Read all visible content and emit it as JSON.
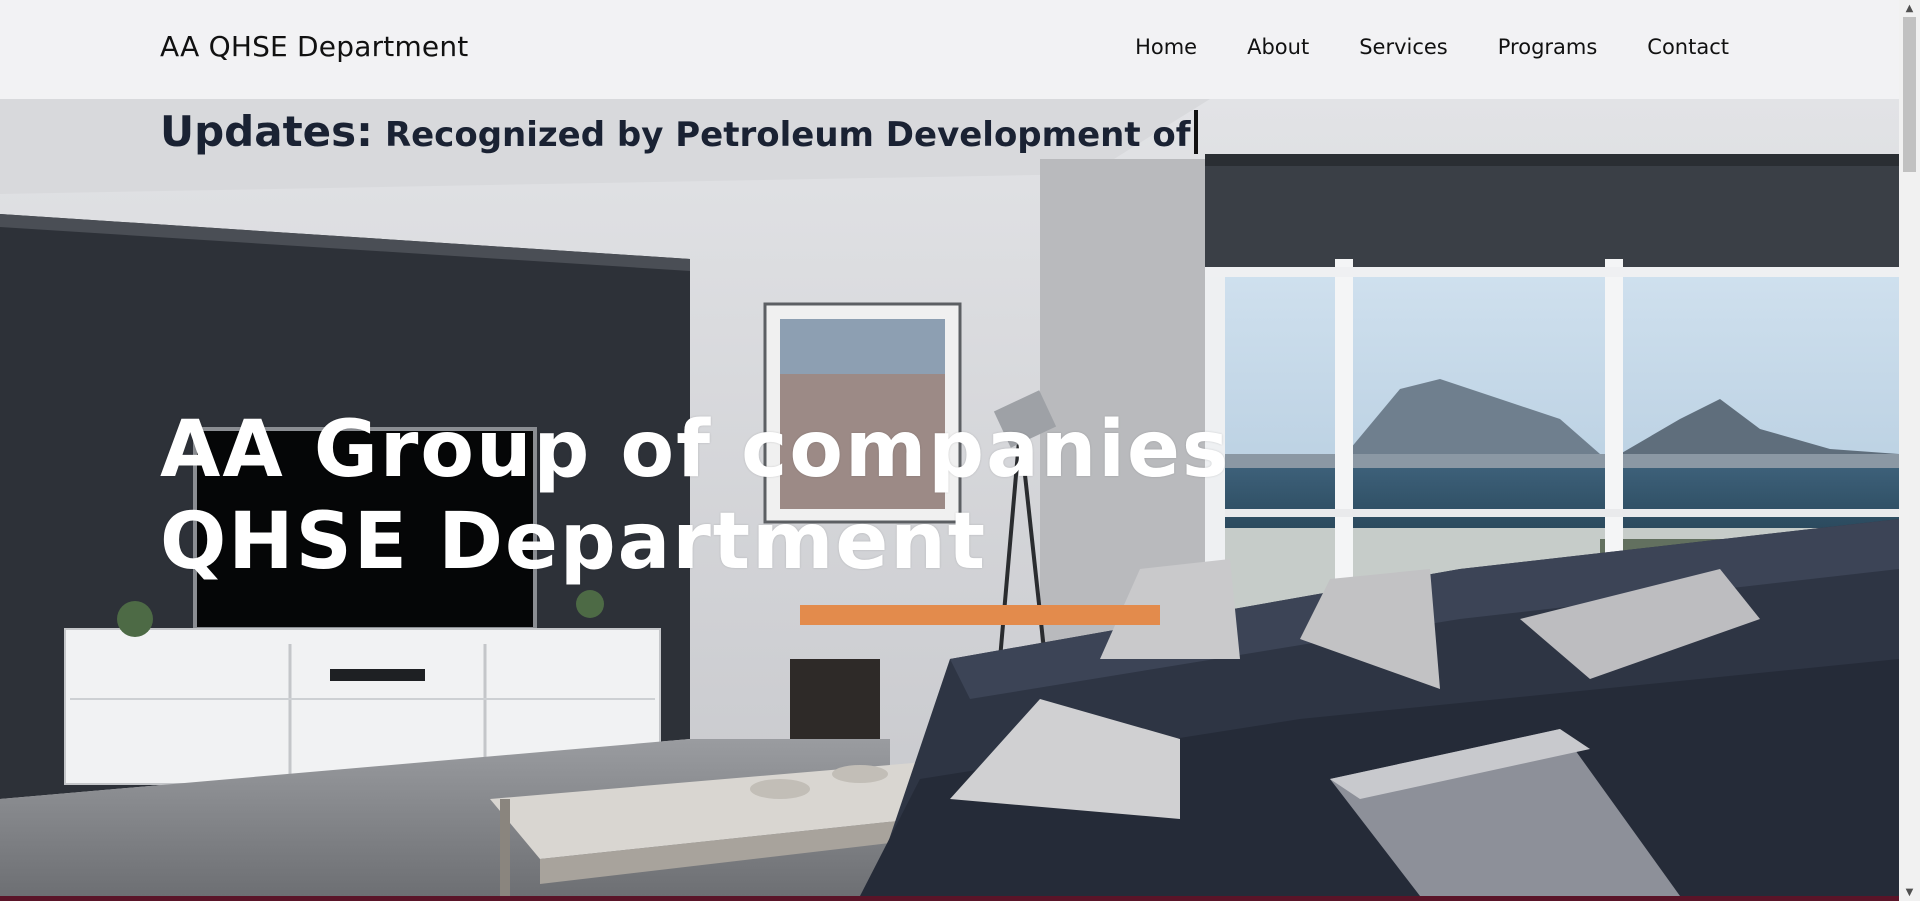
{
  "header": {
    "brand": "AA QHSE Department",
    "nav": [
      "Home",
      "About",
      "Services",
      "Programs",
      "Contact"
    ]
  },
  "hero": {
    "updates_label": "Updates:",
    "updates_text": "Recognized by Petroleum Development of",
    "headline_line1": "AA Group of companies",
    "headline_line2": "QHSE Department"
  },
  "colors": {
    "accent": "#e38b4c",
    "footer_strip": "#5a1428",
    "header_bg": "#f2f2f4",
    "headline": "#ffffff",
    "updates_text": "#1a2233"
  },
  "icons": {
    "scroll_up": "triangle-up-icon",
    "scroll_down": "triangle-down-icon"
  }
}
